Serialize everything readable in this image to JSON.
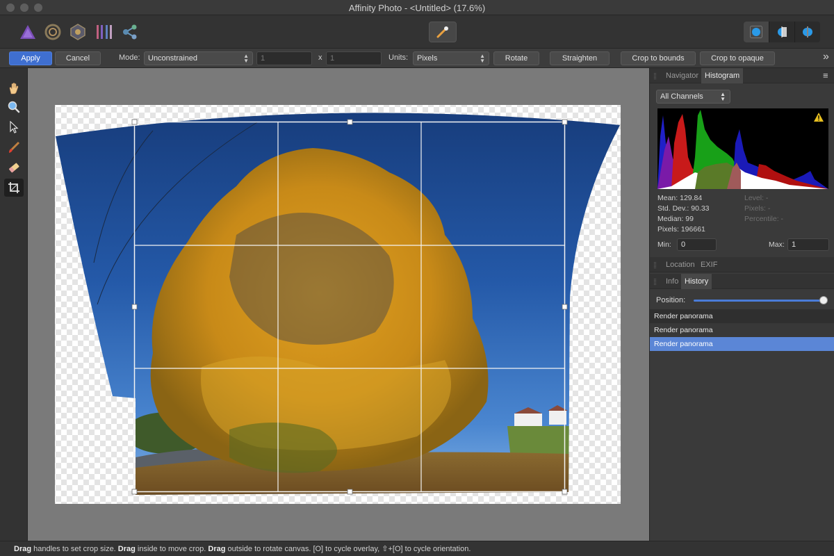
{
  "window": {
    "title": "Affinity Photo - <Untitled> (17.6%)"
  },
  "toolbar": {
    "personas": [
      "photo-persona-icon",
      "liquify-persona-icon",
      "develop-persona-icon",
      "tone-mapping-persona-icon",
      "export-persona-icon"
    ],
    "center_tool": "crop-brush-icon",
    "view_modes": [
      "single-view-icon",
      "split-view-icon",
      "mirror-view-icon"
    ]
  },
  "context": {
    "apply_label": "Apply",
    "cancel_label": "Cancel",
    "mode_label": "Mode:",
    "mode_value": "Unconstrained",
    "width_value": "1",
    "x_label": "x",
    "height_value": "1",
    "units_label": "Units:",
    "units_value": "Pixels",
    "rotate_label": "Rotate",
    "straighten_label": "Straighten",
    "crop_bounds_label": "Crop to bounds",
    "crop_opaque_label": "Crop to opaque",
    "more_icon": "»"
  },
  "tools": [
    "view-tool-icon",
    "zoom-tool-icon",
    "move-tool-icon",
    "paint-brush-icon",
    "eraser-icon",
    "crop-tool-icon"
  ],
  "panel": {
    "tabs_top": [
      "Navigator",
      "Histogram"
    ],
    "channel_select": "All Channels",
    "stats": {
      "mean": "Mean: 129.84",
      "stddev": "Std. Dev.: 90.33",
      "median": "Median: 99",
      "pixels": "Pixels: 196661",
      "level": "Level: -",
      "pixels2": "Pixels: -",
      "percentile": "Percentile: -"
    },
    "min_label": "Min:",
    "min_value": "0",
    "max_label": "Max:",
    "max_value": "1",
    "tabs_mid": [
      "Location",
      "EXIF"
    ],
    "tabs_low": [
      "Info",
      "History"
    ],
    "position_label": "Position:",
    "position_value": 1.0,
    "history": [
      "Render panorama",
      "Render panorama",
      "Render panorama"
    ],
    "colors": {
      "selected_row": "#5b86d6",
      "accent": "#3f6fd0"
    }
  },
  "status": {
    "s1": "Drag",
    "s2": " handles to set crop size. ",
    "s3": "Drag",
    "s4": " inside to move crop. ",
    "s5": "Drag",
    "s6": " outside to rotate canvas. [O] to cycle overlay, ⇧+[O] to cycle orientation."
  }
}
